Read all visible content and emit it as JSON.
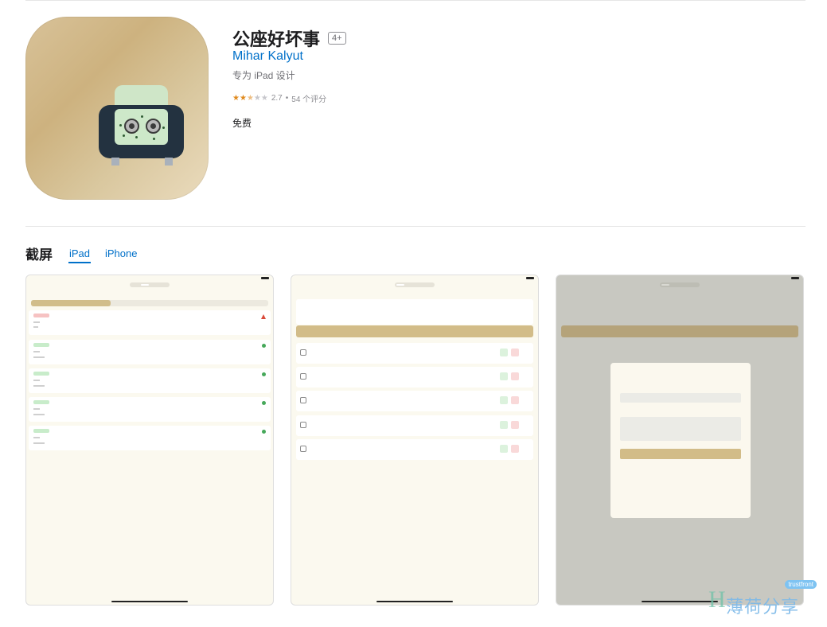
{
  "app": {
    "title": "公座好坏事",
    "age_rating": "4+",
    "developer": "Mihar Kalyut",
    "designed_for": "专为 iPad 设计",
    "rating_value": "2.7",
    "rating_sep": "•",
    "rating_count": "54 个评分",
    "rating_stars": 2.7,
    "price": "免费",
    "colors": {
      "link": "#0070c9",
      "star": "#e08a1e"
    }
  },
  "screenshots": {
    "section_title": "截屏",
    "tabs": [
      {
        "label": "iPad",
        "selected": true
      },
      {
        "label": "iPhone",
        "selected": false
      }
    ]
  },
  "watermark": {
    "badge": "trustfront",
    "letter": "H",
    "text": "薄荷分享"
  }
}
